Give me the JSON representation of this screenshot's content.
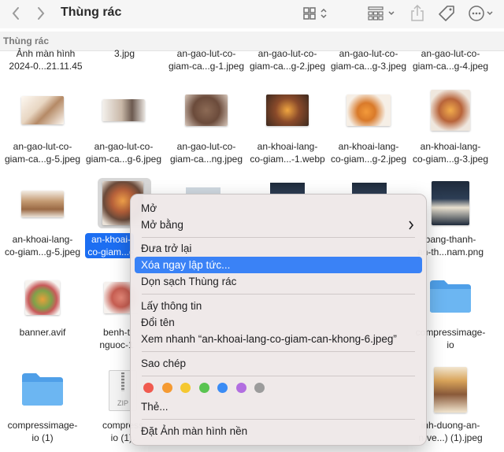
{
  "window": {
    "title": "Thùng rác",
    "path_label": "Thùng rác"
  },
  "toolbar": {
    "back_icon": "chevron-left-icon",
    "forward_icon": "chevron-right-icon",
    "view_icon": "grid-view-icon",
    "group_icon": "group-icon",
    "share_icon": "share-icon",
    "tag_icon": "tag-icon",
    "more_icon": "ellipsis-icon"
  },
  "files": {
    "row0": [
      "Ảnh màn hình\n2024-0...21.11.45",
      "3.jpg",
      "an-gao-lut-co-\ngiam-ca...g-1.jpeg",
      "an-gao-lut-co-\ngiam-ca...g-2.jpeg",
      "an-gao-lut-co-\ngiam-ca...g-3.jpeg",
      "an-gao-lut-co-\ngiam-ca...g-4.jpeg"
    ],
    "row1": [
      "an-gao-lut-co-\ngiam-ca...g-5.jpeg",
      "an-gao-lut-co-\ngiam-ca...g-6.jpeg",
      "an-gao-lut-co-\ngiam-ca...ng.jpeg",
      "an-khoai-lang-\nco-giam...-1.webp",
      "an-khoai-lang-\nco-giam...g-2.jpeg",
      "an-khoai-lang-\nco-giam...g-3.jpeg"
    ],
    "row2": [
      "an-khoai-lang-\nco-giam...g-5.jpeg",
      "an-khoai-\nco-giam...g",
      "",
      "",
      "",
      "bang-thanh-\nan-th...nam.png"
    ],
    "row3": [
      "banner.avif",
      "benh-t\nnguoc-1",
      "",
      "",
      "",
      "compressimage-\nio"
    ],
    "row4": [
      "compressimage-\nio (1)",
      "compress\nio (1).",
      "",
      "",
      "",
      "inh-duong-an-\nn-ve...) (1).jpeg"
    ]
  },
  "zip_label": "ZIP",
  "menu": {
    "open": "Mở",
    "open_with": "Mở bằng",
    "put_back": "Đưa trở lại",
    "delete_immediately": "Xóa ngay lập tức...",
    "empty_trash": "Dọn sạch Thùng rác",
    "get_info": "Lấy thông tin",
    "rename": "Đổi tên",
    "quick_look": "Xem nhanh “an-khoai-lang-co-giam-can-khong-6.jpeg”",
    "copy": "Sao chép",
    "tags": "Thẻ...",
    "set_wallpaper": "Đặt Ảnh màn hình nền",
    "tag_colors": [
      "#f05a4f",
      "#f59a32",
      "#f5c831",
      "#5ac451",
      "#3b8cf5",
      "#b26ee0",
      "#9c9c9c"
    ]
  },
  "colors": {
    "selection": "#1c6ef2",
    "menu_highlight": "#3a82f6",
    "folder": "#5aabf0"
  }
}
